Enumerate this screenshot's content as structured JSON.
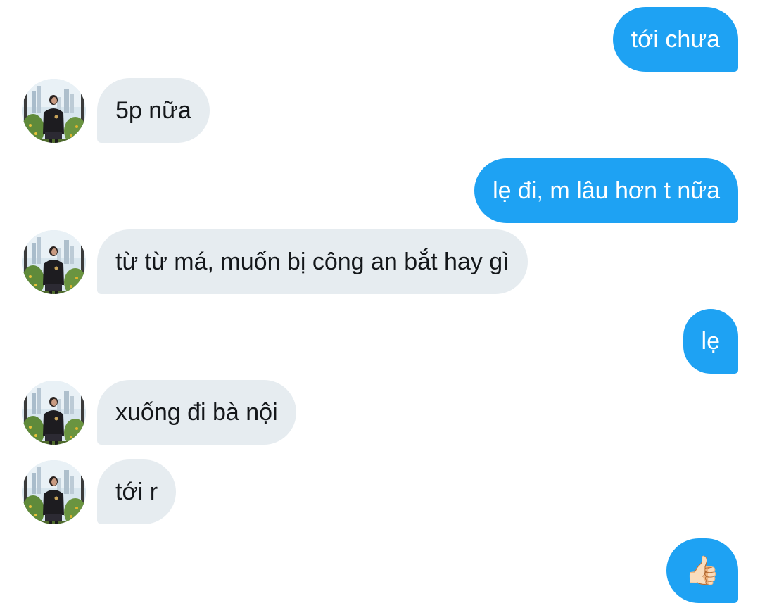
{
  "messages": [
    {
      "side": "out",
      "text": "tới chưa"
    },
    {
      "side": "in",
      "text": "5p nữa"
    },
    {
      "side": "out",
      "text": "lẹ đi, m lâu hơn t nữa"
    },
    {
      "side": "in",
      "text": "từ từ má, muốn bị công an bắt hay gì"
    },
    {
      "side": "out",
      "text": "lẹ"
    },
    {
      "side": "in",
      "text": "xuống đi bà nội"
    },
    {
      "side": "in",
      "text": "tới r"
    },
    {
      "side": "out",
      "text": "👍🏻"
    }
  ],
  "colors": {
    "outgoing_bubble": "#1ea2f3",
    "incoming_bubble": "#e6ecf0"
  },
  "icons": {
    "avatar": "profile-photo",
    "reaction": "thumbs-up-icon"
  }
}
